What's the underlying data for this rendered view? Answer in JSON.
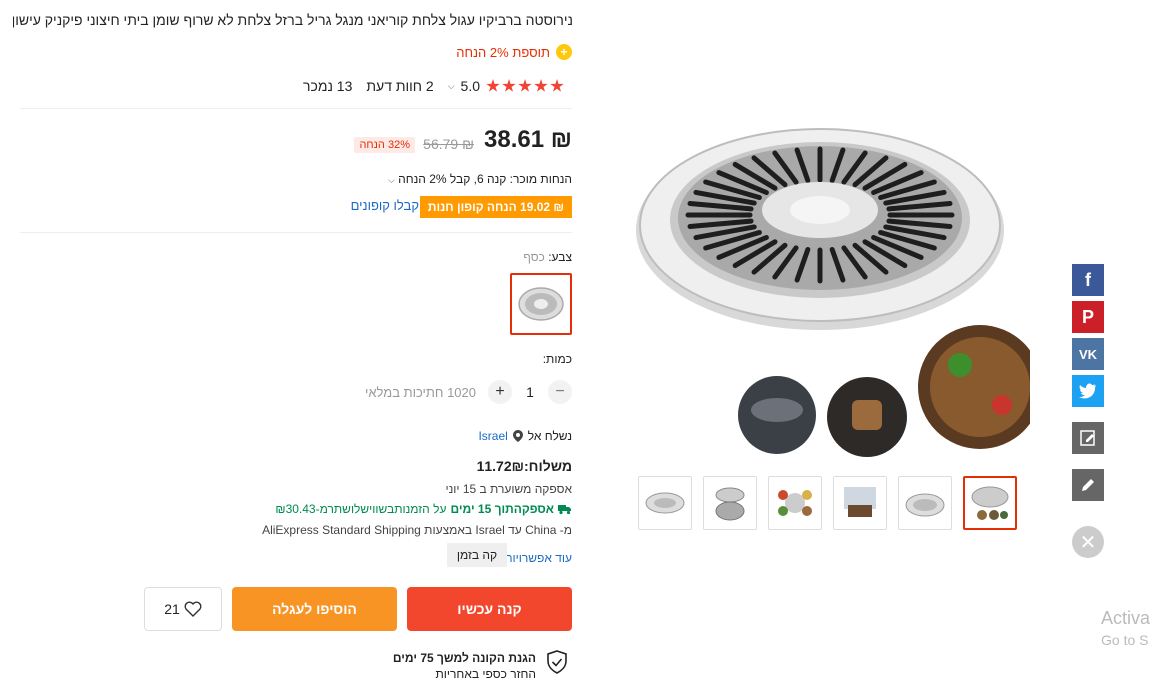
{
  "product": {
    "title": "נירוסטה ברביקיו עגול צלחת קוריאני מנגל גריל ברזל צלחת לא שרוף שומן ביתי חיצוני פיקניק עישון כלים",
    "extra_discount": "תוספת 2% הנחה",
    "rating_value": "5.0",
    "reviews": "2 חוות דעת",
    "sold": "13 נמכר"
  },
  "price": {
    "current": "₪ 38.61",
    "original": "₪ 56.79",
    "discount": "32% הנחה",
    "seller_discounts": "הנחות מוכר: קנה 6, קבל 2% הנחה",
    "coupon": "₪ 19.02 הנחה קופון חנות",
    "get_coupons": "קבלו קופונים"
  },
  "color": {
    "label": "צבע:",
    "value": "כסף"
  },
  "quantity": {
    "label": "כמות:",
    "value": "1",
    "available": "1020 חתיכות במלאי"
  },
  "shipping": {
    "ship_to_label": "נשלח אל",
    "country": "Israel",
    "cost": "משלוח:11.72₪",
    "eta": "אספקה משוערת ב 15 יוני",
    "promo_bold": "אספקהתוך 15 ימים",
    "promo_rest": "על הזמנותבשווישלושתרמ-₪30.43",
    "via": "מ- China עד Israel באמצעות AliExpress Standard Shipping",
    "more_options": "עוד אפשרויות",
    "tooltip": "קה בזמן"
  },
  "actions": {
    "buy_now": "קנה עכשיו",
    "add_to_cart": "הוסיפו לעגלה",
    "wishlist_count": "21"
  },
  "guarantee": {
    "title": "הגנת הקונה למשך 75 ימים",
    "subtitle": "החזר כספי באחריות"
  },
  "overlay": {
    "line1": "Activa",
    "line2": "Go to S"
  },
  "colors": {
    "accent": "#e62e04",
    "buy": "#f2472d",
    "cart": "#f79423",
    "link": "#1c6ac8"
  }
}
